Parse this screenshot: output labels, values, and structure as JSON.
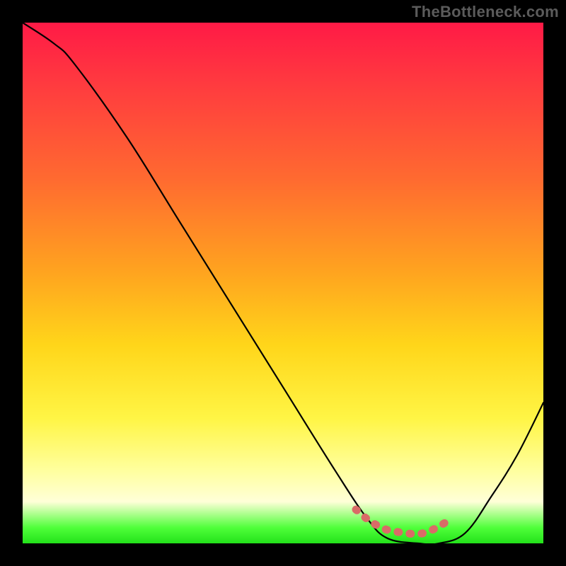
{
  "watermark": "TheBottleneck.com",
  "chart_data": {
    "type": "line",
    "title": "",
    "xlabel": "",
    "ylabel": "",
    "xlim": [
      0,
      100
    ],
    "ylim": [
      0,
      100
    ],
    "series": [
      {
        "name": "bottleneck-curve",
        "x": [
          0,
          6,
          10,
          20,
          30,
          40,
          50,
          60,
          66,
          70,
          76,
          80,
          85,
          90,
          95,
          100
        ],
        "y": [
          100,
          96,
          92,
          78,
          62,
          46,
          30,
          14,
          5,
          1,
          0,
          0,
          2,
          9,
          17,
          27
        ]
      },
      {
        "name": "optimal-marker",
        "x": [
          64,
          66,
          68,
          70,
          72,
          74,
          76,
          78,
          80,
          82
        ],
        "y": [
          6.5,
          4.8,
          3.5,
          2.6,
          2.2,
          1.9,
          1.8,
          2.3,
          3.3,
          4.5
        ]
      }
    ],
    "gradient_stops": [
      {
        "pos": 0,
        "color": "#ff1a46"
      },
      {
        "pos": 12,
        "color": "#ff3b3f"
      },
      {
        "pos": 30,
        "color": "#ff6a30"
      },
      {
        "pos": 48,
        "color": "#ffa41f"
      },
      {
        "pos": 62,
        "color": "#ffd61a"
      },
      {
        "pos": 76,
        "color": "#fff545"
      },
      {
        "pos": 86,
        "color": "#ffff9e"
      },
      {
        "pos": 92,
        "color": "#ffffd8"
      },
      {
        "pos": 97,
        "color": "#4fff3a"
      },
      {
        "pos": 100,
        "color": "#23e21a"
      }
    ],
    "colors": {
      "curve": "#000000",
      "marker": "#d96b67",
      "background_frame": "#000000"
    }
  }
}
